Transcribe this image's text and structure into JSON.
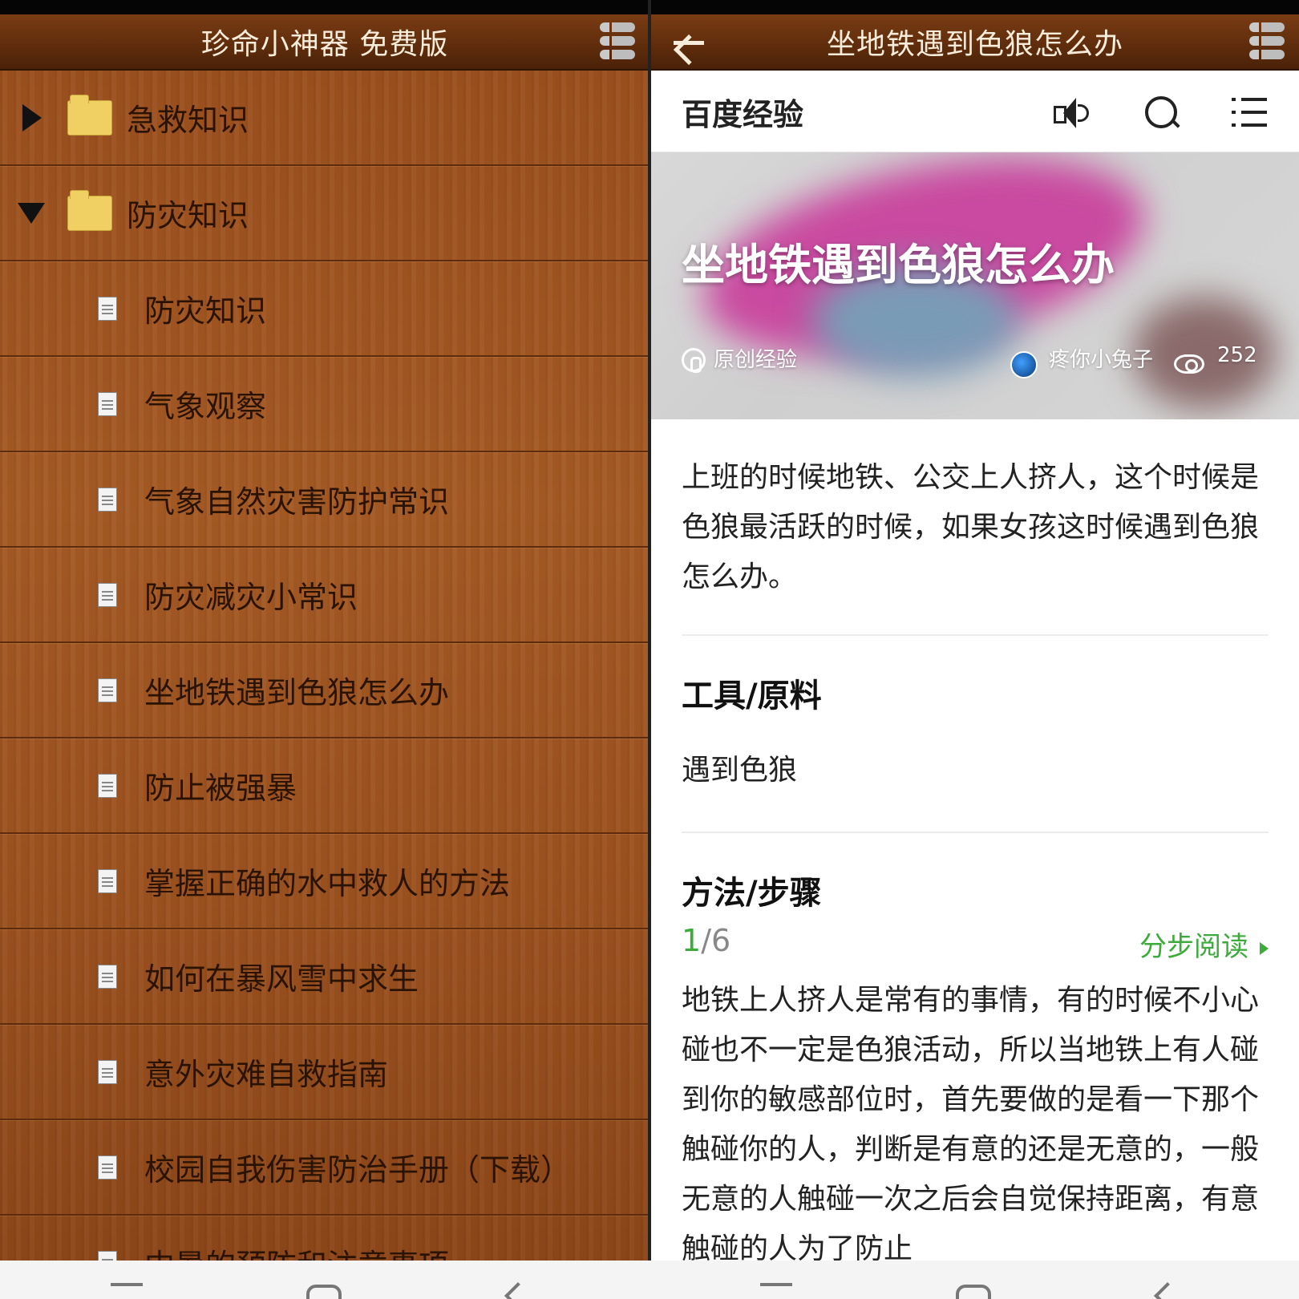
{
  "left": {
    "title": "珍命小神器 免费版",
    "tree": [
      {
        "type": "folder",
        "expanded": false,
        "label": "急救知识"
      },
      {
        "type": "folder",
        "expanded": true,
        "label": "防灾知识"
      },
      {
        "type": "doc",
        "label": "防灾知识"
      },
      {
        "type": "doc",
        "label": "气象观察"
      },
      {
        "type": "doc",
        "label": "气象自然灾害防护常识"
      },
      {
        "type": "doc",
        "label": "防灾减灾小常识"
      },
      {
        "type": "doc",
        "label": "坐地铁遇到色狼怎么办"
      },
      {
        "type": "doc",
        "label": "防止被强暴"
      },
      {
        "type": "doc",
        "label": "掌握正确的水中救人的方法"
      },
      {
        "type": "doc",
        "label": "如何在暴风雪中求生"
      },
      {
        "type": "doc",
        "label": "意外灾难自救指南"
      },
      {
        "type": "doc",
        "label": "校园自我伤害防治手册（下载）"
      },
      {
        "type": "doc",
        "label": "中暑的预防和注意事项"
      }
    ]
  },
  "right": {
    "title": "坐地铁遇到色狼怎么办",
    "brand": "百度经验",
    "hero": {
      "title": "坐地铁遇到色狼怎么办",
      "original_label": "原创经验",
      "author": "疼你小兔子",
      "views": "252"
    },
    "intro": "上班的时候地铁、公交上人挤人，这个时候是色狼最活跃的时候，如果女孩这时候遇到色狼怎么办。",
    "tools": {
      "heading": "工具/原料",
      "text": "遇到色狼"
    },
    "steps": {
      "heading": "方法/步骤",
      "current": "1",
      "total": "/6",
      "read_label": "分步阅读",
      "text": "地铁上人挤人是常有的事情，有的时候不小心碰也不一定是色狼活动，所以当地铁上有人碰到你的敏感部位时，首先要做的是看一下那个触碰你的人，判断是有意的还是无意的，一般无意的人触碰一次之后会自觉保持距离，有意触碰的人为了防止"
    }
  },
  "colors": {
    "wood": "#9c5220",
    "accent_green": "#3cab3c",
    "title_text": "#f6ecd9"
  }
}
